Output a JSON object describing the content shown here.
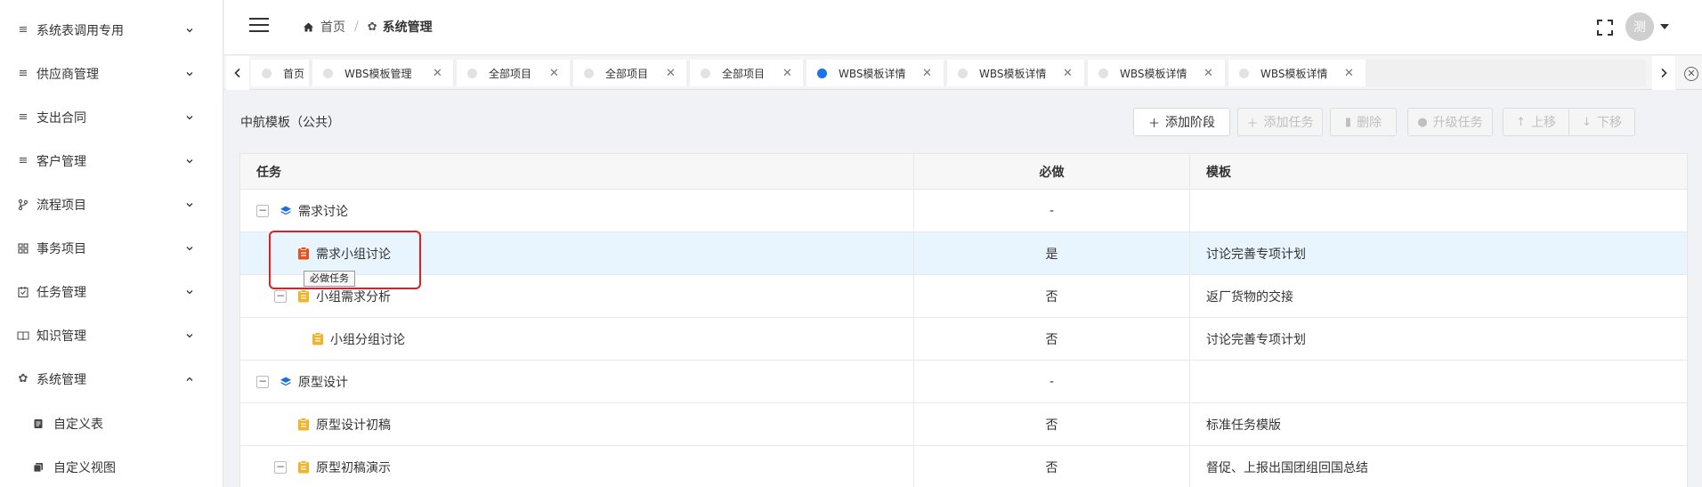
{
  "sidebar": {
    "items": [
      {
        "label": "系统表调用专用",
        "icon": "menu-icon"
      },
      {
        "label": "供应商管理",
        "icon": "menu-icon"
      },
      {
        "label": "支出合同",
        "icon": "menu-icon"
      },
      {
        "label": "客户管理",
        "icon": "menu-icon"
      },
      {
        "label": "流程项目",
        "icon": "branch-icon"
      },
      {
        "label": "事务项目",
        "icon": "grid-icon"
      },
      {
        "label": "任务管理",
        "icon": "checklist-icon"
      },
      {
        "label": "知识管理",
        "icon": "book-icon"
      },
      {
        "label": "系统管理",
        "icon": "gear-icon"
      }
    ],
    "sub_items": [
      {
        "label": "自定义表",
        "icon": "table-icon"
      },
      {
        "label": "自定义视图",
        "icon": "view-icon"
      }
    ]
  },
  "header": {
    "breadcrumb": {
      "home": "首页",
      "separator": "/",
      "current": "系统管理"
    },
    "avatar_text": "测"
  },
  "tabs": [
    {
      "label": "首页",
      "closable": false,
      "active": false
    },
    {
      "label": "WBS模板管理",
      "closable": true,
      "active": false
    },
    {
      "label": "全部项目",
      "closable": true,
      "active": false
    },
    {
      "label": "全部项目",
      "closable": true,
      "active": false
    },
    {
      "label": "全部项目",
      "closable": true,
      "active": false
    },
    {
      "label": "WBS模板详情",
      "closable": true,
      "active": true
    },
    {
      "label": "WBS模板详情",
      "closable": true,
      "active": false
    },
    {
      "label": "WBS模板详情",
      "closable": true,
      "active": false
    },
    {
      "label": "WBS模板详情",
      "closable": true,
      "active": false
    }
  ],
  "toolbar": {
    "template_title": "中航模板（公共）",
    "add_stage": "添加阶段",
    "add_task": "添加任务",
    "delete": "删除",
    "upgrade_task": "升级任务",
    "move_up": "上移",
    "move_down": "下移"
  },
  "table": {
    "headers": {
      "task": "任务",
      "required": "必做",
      "template": "模板"
    },
    "rows": [
      {
        "task": "需求讨论",
        "required": "-",
        "template": "",
        "type": "stage"
      },
      {
        "task": "需求小组讨论",
        "required": "是",
        "template": "讨论完善专项计划",
        "type": "task-required"
      },
      {
        "task": "小组需求分析",
        "required": "否",
        "template": "返厂货物的交接",
        "type": "task"
      },
      {
        "task": "小组分组讨论",
        "required": "否",
        "template": "讨论完善专项计划",
        "type": "task"
      },
      {
        "task": "原型设计",
        "required": "-",
        "template": "",
        "type": "stage"
      },
      {
        "task": "原型设计初稿",
        "required": "否",
        "template": "标准任务模版",
        "type": "task"
      },
      {
        "task": "原型初稿演示",
        "required": "否",
        "template": "督促、上报出国团组回国总结",
        "type": "task"
      }
    ]
  },
  "tooltip": "必做任务",
  "colors": {
    "accent": "#1a73e8",
    "stage_icon": "#1a6fd8",
    "task_icon": "#f0b429",
    "required_task_icon": "#e0531b",
    "highlight_row": "#e8f4fe",
    "annotation": "#e02020"
  }
}
